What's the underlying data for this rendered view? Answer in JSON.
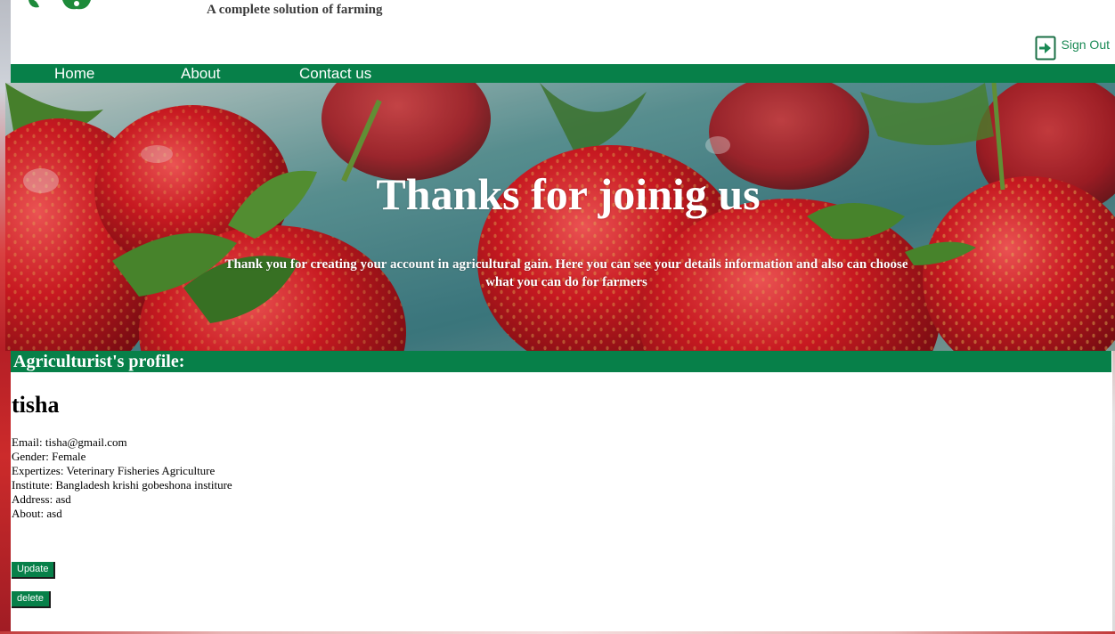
{
  "header": {
    "tagline": "A complete solution of farming",
    "sign_out_label": "Sign Out"
  },
  "nav": {
    "items": [
      "Home",
      "About",
      "Contact us"
    ]
  },
  "hero": {
    "title": "Thanks for joinig us",
    "subtitle": "Thank you for creating your account in agricultural gain. Here you can see your details information and also can choose what you can do for farmers"
  },
  "profile": {
    "section_title": "Agriculturist's profile:",
    "name": "tisha",
    "details": [
      "Email: tisha@gmail.com",
      "Gender: Female",
      "Expertizes: Veterinary Fisheries Agriculture",
      "Institute: Bangladesh krishi gobeshona institure",
      "Address: asd",
      "About: asd"
    ],
    "update_label": "Update",
    "delete_label": "delete"
  },
  "colors": {
    "brand_green": "#078049",
    "white": "#ffffff"
  },
  "icons": [
    "logo-leaf-icon",
    "sign-out-icon"
  ]
}
